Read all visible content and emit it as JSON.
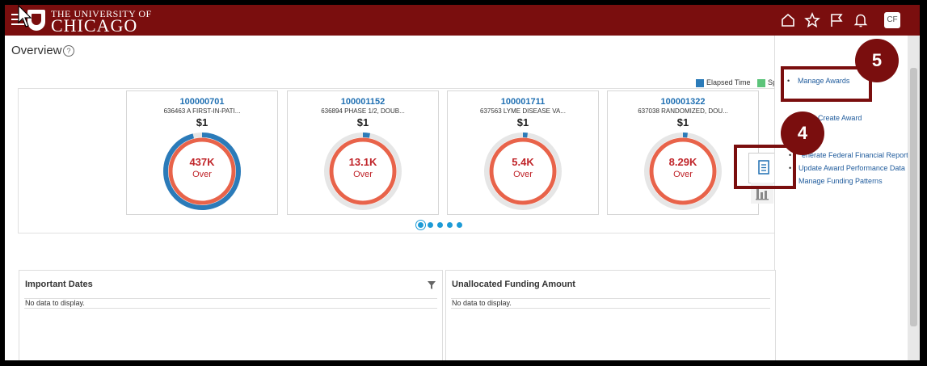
{
  "header": {
    "logo_top": "THE UNIVERSITY OF",
    "logo_bottom": "CHICAGO",
    "avatar_initials": "CF"
  },
  "page": {
    "title": "Overview"
  },
  "legend": {
    "items": [
      {
        "label": "Elapsed Time",
        "color": "#2b7bb9"
      },
      {
        "label": "Sp",
        "color": "#5cc47a"
      }
    ]
  },
  "cards": [
    {
      "id": "100000701",
      "name": "636463 A FIRST-IN-PATI...",
      "amount": "$1",
      "value": "437K",
      "status": "Over",
      "elapsed": 0.96
    },
    {
      "id": "100001152",
      "name": "636894 PHASE 1/2, DOUB...",
      "amount": "$1",
      "value": "13.1K",
      "status": "Over",
      "elapsed": 0.03
    },
    {
      "id": "100001711",
      "name": "637563 LYME DISEASE VA...",
      "amount": "$1",
      "value": "5.4K",
      "status": "Over",
      "elapsed": 0.02
    },
    {
      "id": "100001322",
      "name": "637038 RANDOMIZED, DOU...",
      "amount": "$1",
      "value": "8.29K",
      "status": "Over",
      "elapsed": 0.02
    }
  ],
  "pager": {
    "count": 5,
    "active": 0
  },
  "tasks": {
    "manage_awards": "Manage Awards",
    "create_award": "Create Award",
    "generate_report": "enerate Federal Financial Report",
    "update_performance": "Update Award Performance Data",
    "manage_funding": "Manage Funding Patterns"
  },
  "callouts": {
    "first": "5",
    "second": "4"
  },
  "panels": {
    "important_dates": {
      "title": "Important Dates",
      "empty": "No data to display."
    },
    "unallocated_funding": {
      "title": "Unallocated Funding Amount",
      "empty": "No data to display."
    }
  },
  "colors": {
    "brand": "#7a0e0e",
    "link": "#1f6fb2",
    "over": "#c0252a",
    "ring_spent": "#e8634a",
    "ring_elapsed": "#2b7bb9"
  }
}
